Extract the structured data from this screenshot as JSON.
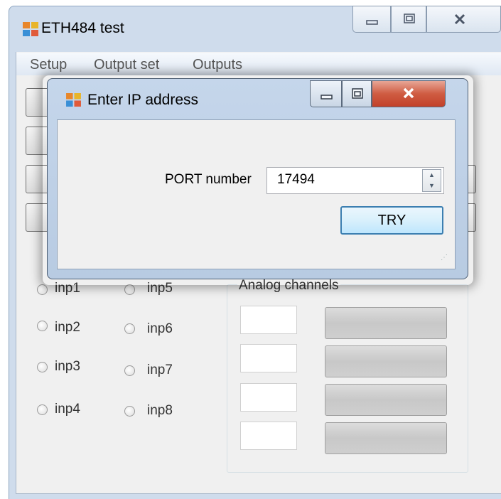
{
  "main_window": {
    "title": "ETH484 test",
    "menu": [
      "Setup",
      "Output set",
      "Outputs"
    ]
  },
  "inputs": {
    "col1": [
      "inp1",
      "inp2",
      "inp3",
      "inp4"
    ],
    "col2": [
      "inp5",
      "inp6",
      "inp7",
      "inp8"
    ]
  },
  "analog": {
    "title": "Analog channels"
  },
  "dialog": {
    "title": "Enter IP address",
    "port_label": "PORT number",
    "port_value": "17494",
    "try_label": "TRY"
  },
  "colors": {
    "close_button": "#c2412a",
    "accent_border": "#3c7fb1"
  }
}
